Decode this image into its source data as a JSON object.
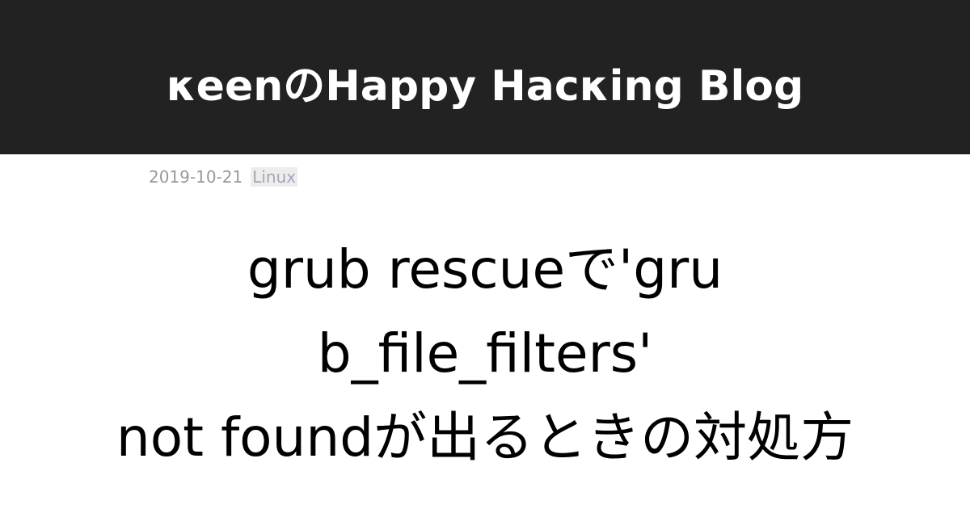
{
  "header": {
    "site_title": "κeenのHappy Hacκing Blog"
  },
  "post": {
    "date": "2019-10-21",
    "tag": "Linux",
    "title_lines": [
      "grub rescueで'gru",
      "b_file_filters'",
      "not foundが出るときの対処方"
    ]
  }
}
